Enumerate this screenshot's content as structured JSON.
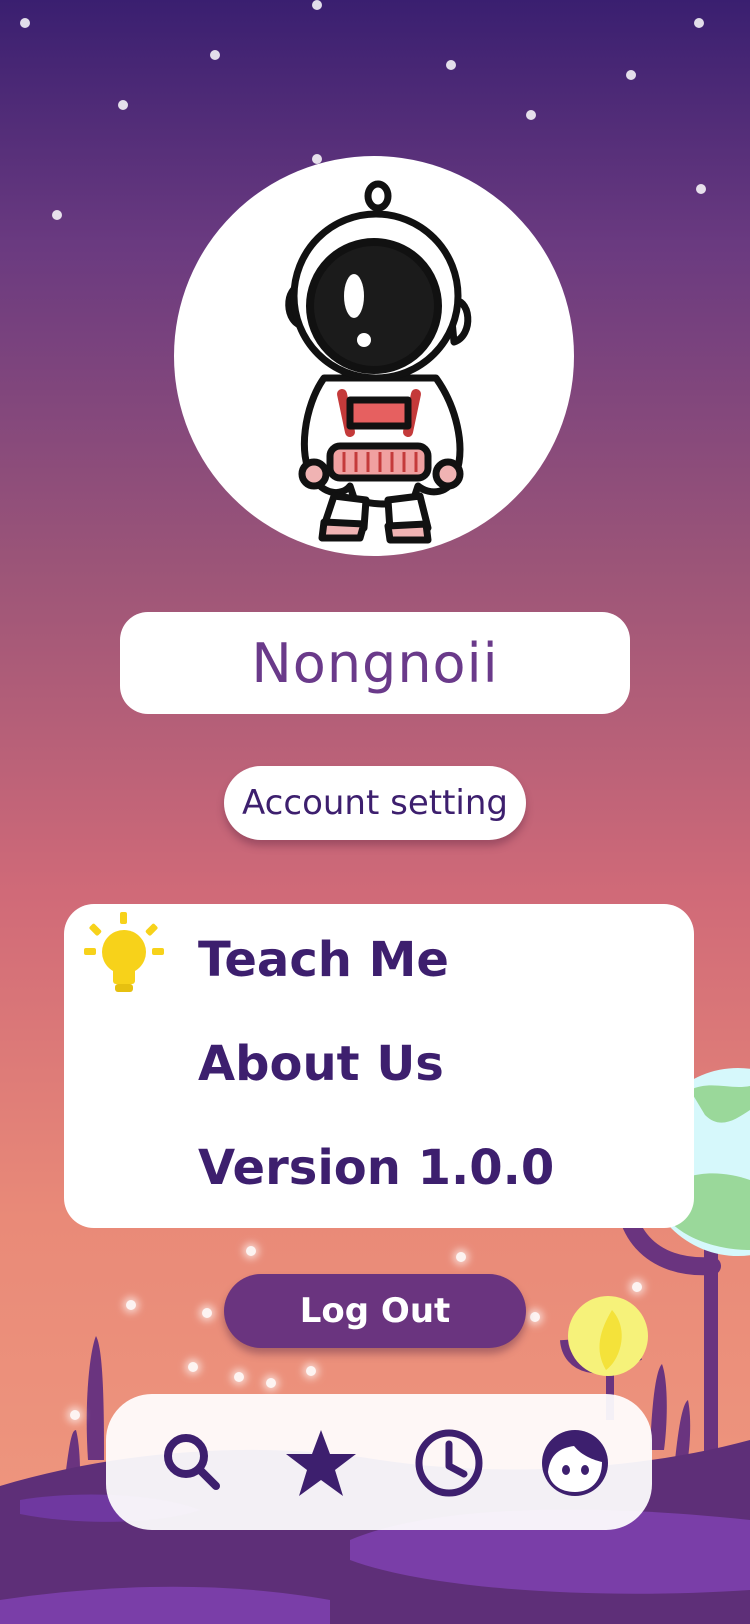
{
  "profile": {
    "username": "Nongnoii",
    "account_setting_label": "Account setting"
  },
  "menu": {
    "items": [
      {
        "label": "Teach Me"
      },
      {
        "label": "About Us"
      },
      {
        "label": "Version 1.0.0"
      }
    ]
  },
  "logout_label": "Log Out",
  "nav": {
    "icons": [
      "search-icon",
      "star-icon",
      "clock-icon",
      "face-icon"
    ]
  },
  "colors": {
    "primary": "#3d1f6e",
    "accent": "#6a347f",
    "bulb": "#f7d21a"
  }
}
